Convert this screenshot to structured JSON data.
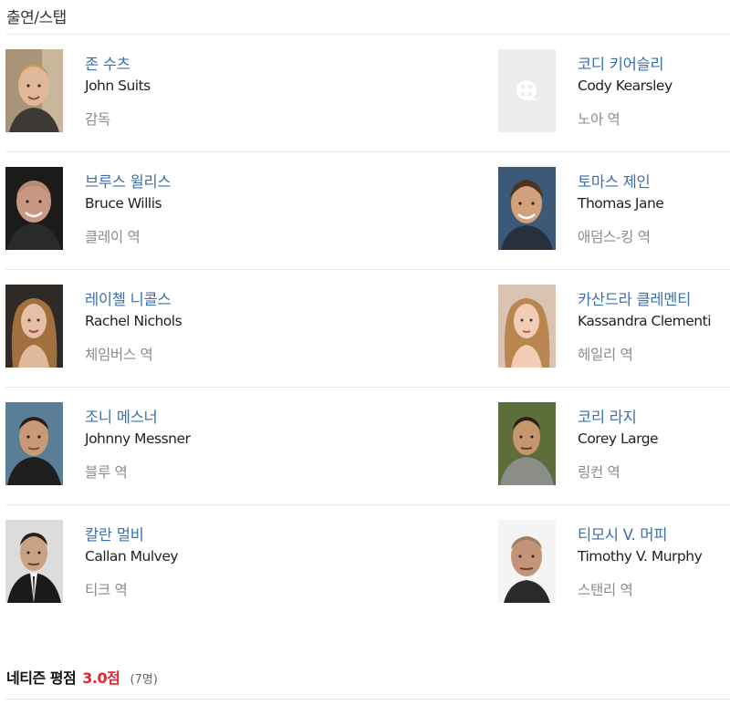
{
  "section": {
    "title": "출연/스탭"
  },
  "cast": [
    {
      "name_ko": "존 수츠",
      "name_en": "John Suits",
      "role": "감독",
      "photo": "portrait-john-suits"
    },
    {
      "name_ko": "코디 키어슬리",
      "name_en": "Cody Kearsley",
      "role": "노아 역",
      "photo": "film-reel-placeholder-icon"
    },
    {
      "name_ko": "브루스 윌리스",
      "name_en": "Bruce Willis",
      "role": "클레이 역",
      "photo": "portrait-bruce-willis"
    },
    {
      "name_ko": "토마스 제인",
      "name_en": "Thomas Jane",
      "role": "애덤스-킹 역",
      "photo": "portrait-thomas-jane"
    },
    {
      "name_ko": "레이첼 니콜스",
      "name_en": "Rachel Nichols",
      "role": "체임버스 역",
      "photo": "portrait-rachel-nichols"
    },
    {
      "name_ko": "카산드라 클레멘티",
      "name_en": "Kassandra Clementi",
      "role": "헤일리 역",
      "photo": "portrait-kassandra-clementi"
    },
    {
      "name_ko": "조니 메스너",
      "name_en": "Johnny Messner",
      "role": "블루 역",
      "photo": "portrait-johnny-messner"
    },
    {
      "name_ko": "코리 라지",
      "name_en": "Corey Large",
      "role": "링컨 역",
      "photo": "portrait-corey-large"
    },
    {
      "name_ko": "칼란 멀비",
      "name_en": "Callan Mulvey",
      "role": "티크 역",
      "photo": "portrait-callan-mulvey"
    },
    {
      "name_ko": "티모시 V. 머피",
      "name_en": "Timothy V. Murphy",
      "role": "스탠리 역",
      "photo": "portrait-timothy-v-murphy"
    }
  ],
  "rating": {
    "label": "네티즌 평점",
    "score": "3.0점",
    "count": "(7명)"
  },
  "colors": {
    "link": "#3b6fb0",
    "score": "#e8222f",
    "role": "#8a8a8a",
    "divider": "#e9e9e9"
  }
}
